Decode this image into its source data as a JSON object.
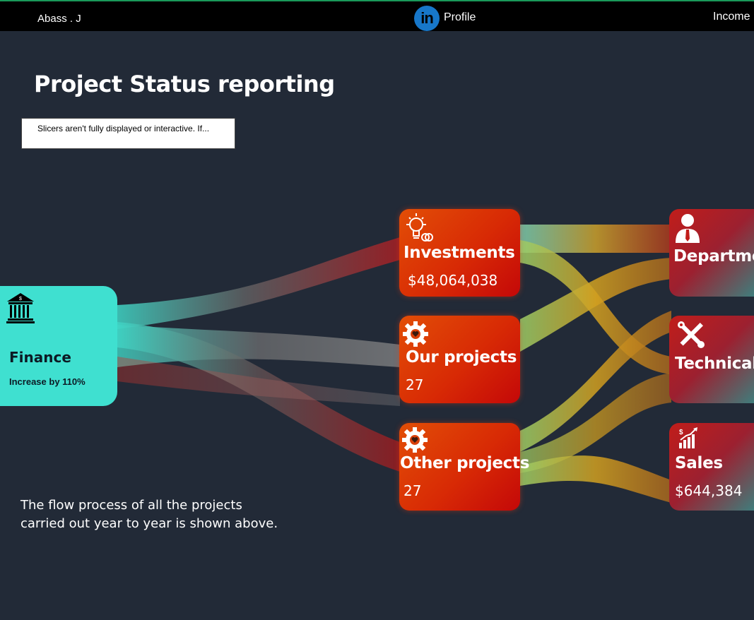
{
  "header": {
    "author": "Abass . J",
    "linkedin_badge": "in",
    "profile_label": "Profile",
    "income_label": "Income"
  },
  "page": {
    "title": "Project Status reporting",
    "slicer_notice": "Slicers aren't fully displayed or interactive. If..."
  },
  "nodes": {
    "finance": {
      "label": "Finance",
      "subtitle": "Increase by 110%",
      "icon": "bank-icon"
    },
    "investments": {
      "label": "Investments",
      "value": "$48,064,038",
      "icon": "lightbulb-coins-icon"
    },
    "our_projects": {
      "label": "Our projects",
      "value": "27",
      "icon": "gear-heart-icon"
    },
    "other_projects": {
      "label": "Other projects",
      "value": "27",
      "icon": "gear-heart-icon"
    },
    "department": {
      "label": "Departme",
      "icon": "person-tie-icon"
    },
    "technical": {
      "label": "Technical",
      "icon": "wrench-screwdriver-icon"
    },
    "sales": {
      "label": "Sales",
      "value": "$644,384",
      "icon": "sales-chart-icon"
    }
  },
  "caption": {
    "line1": "The flow process of  all the projects",
    "line2": "carried out year to year is shown above."
  },
  "colors": {
    "background": "#222a37",
    "finance": "#3fe0d0",
    "orange_node": "#e24e06",
    "red_node": "#c11d1a"
  }
}
